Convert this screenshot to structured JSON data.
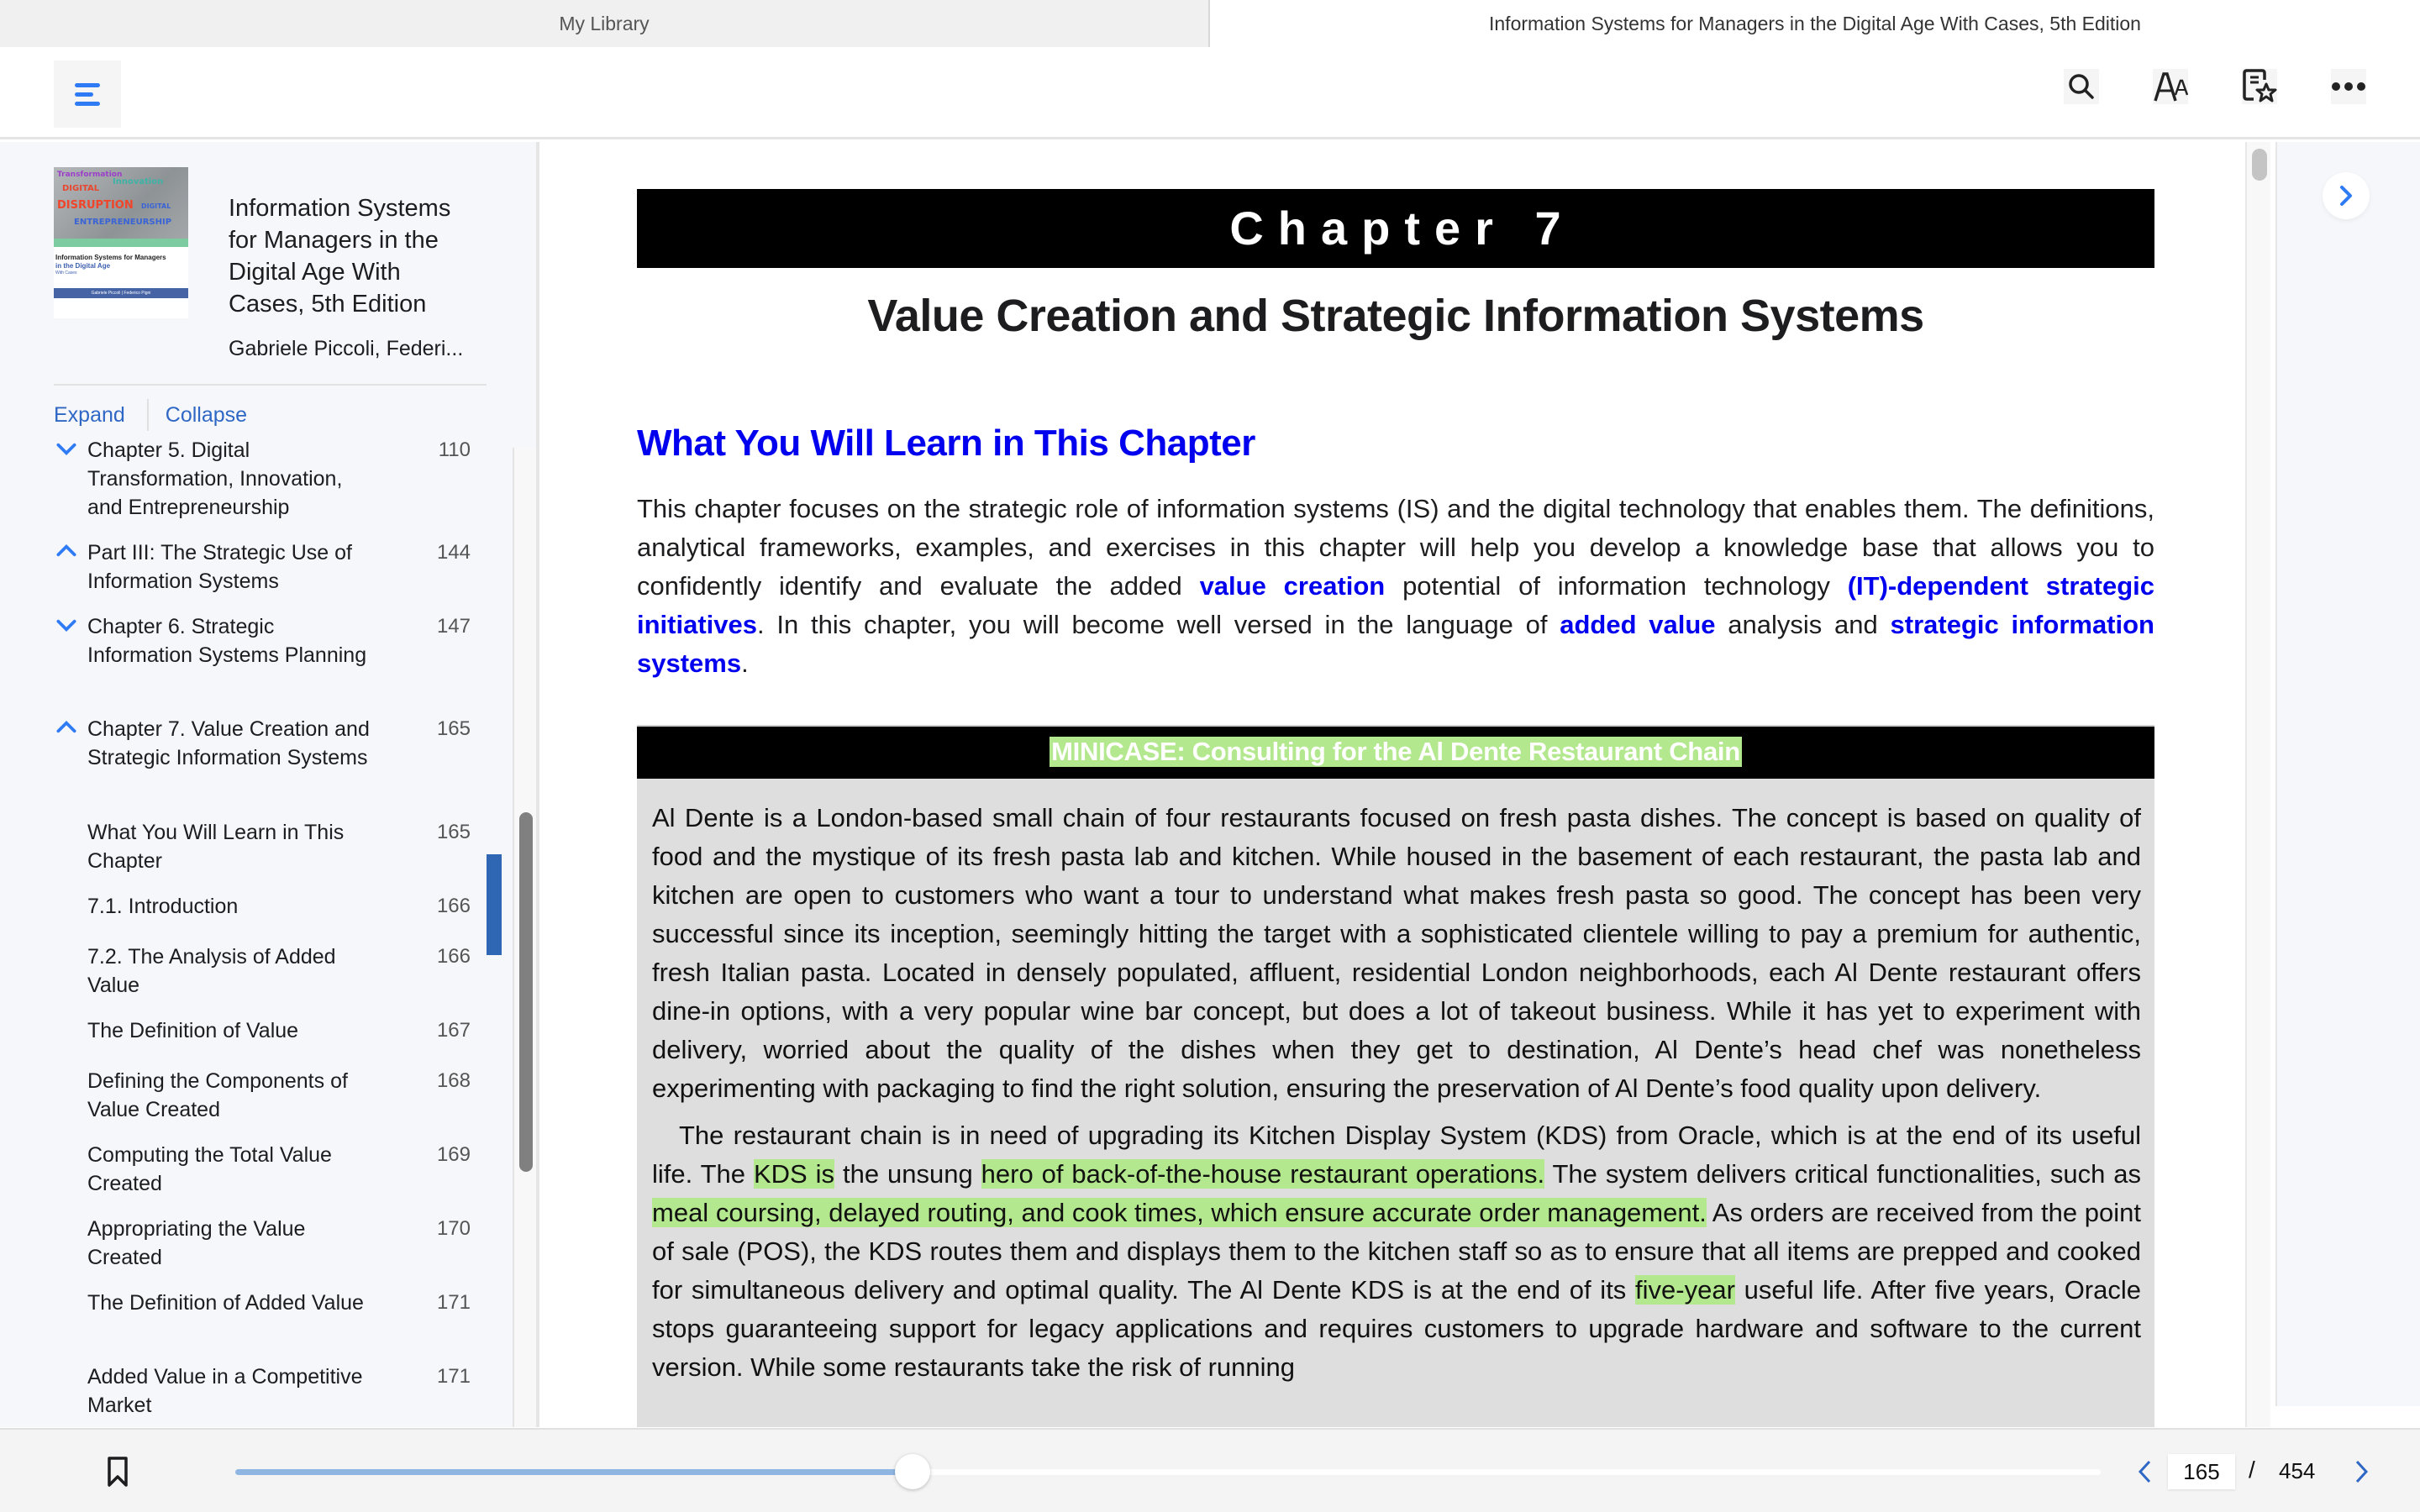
{
  "window": {
    "tabs": [
      {
        "label": "My Library",
        "active": false
      },
      {
        "label": "Information Systems for Managers in the Digital Age With Cases,  5th Edition",
        "active": true
      }
    ]
  },
  "toolbar": {
    "menu_icon": "hamburger-menu-icon",
    "actions": [
      {
        "name": "search",
        "icon": "search-icon"
      },
      {
        "name": "font-size",
        "icon": "text-size-icon"
      },
      {
        "name": "notes-bookmarks",
        "icon": "bookmarked-notes-icon"
      },
      {
        "name": "more",
        "icon": "more-horizontal-icon"
      }
    ]
  },
  "sidebar": {
    "book": {
      "title": "Information Systems for Managers in the Digital Age With Cases,  5th Edition",
      "author": "Gabriele Piccoli, Federi...",
      "cover": {
        "words": [
          "Transformation",
          "DIGITAL",
          "Innovation",
          "DISRUPTION",
          "DIGITAL",
          "ENTREPRENEURSHIP"
        ],
        "title_line1": "Information Systems for Managers",
        "title_line2": "in the Digital Age",
        "title_line3": "With Cases",
        "authors": "Gabriele Piccoli | Federico Pigni"
      },
      "more_label": "•••"
    },
    "expand_label": "Expand",
    "collapse_label": "Collapse",
    "toc": [
      {
        "label": "Chapter 5. Digital Transformation, Innovation, and Entrepreneurship",
        "page": "110",
        "toggle": "collapsed",
        "level": 1
      },
      {
        "label": "Part III: The Strategic Use of Information Systems",
        "page": "144",
        "toggle": "expanded",
        "level": 1
      },
      {
        "label": "Chapter 6. Strategic Information Systems Planning",
        "page": "147",
        "toggle": "collapsed",
        "level": 1
      },
      {
        "label": "Chapter 7. Value Creation and Strategic Information Systems",
        "page": "165",
        "toggle": "expanded",
        "level": 1,
        "current": true
      },
      {
        "label": "What You Will Learn in This Chapter",
        "page": "165",
        "level": 2
      },
      {
        "label": "7.1. Introduction",
        "page": "166",
        "level": 2
      },
      {
        "label": "7.2. The Analysis of Added Value",
        "page": "166",
        "level": 2
      },
      {
        "label": "The Definition of Value",
        "page": "167",
        "level": 2
      },
      {
        "label": "Defining the Components of Value Created",
        "page": "168",
        "level": 2
      },
      {
        "label": "Computing the Total Value Created",
        "page": "169",
        "level": 2
      },
      {
        "label": "Appropriating the Value Created",
        "page": "170",
        "level": 2
      },
      {
        "label": "The Definition of Added Value",
        "page": "171",
        "level": 2
      },
      {
        "label": "Added Value in a Competitive Market",
        "page": "171",
        "level": 2
      }
    ]
  },
  "content": {
    "chapter_banner": "Chapter 7",
    "chapter_title": "Value Creation and Strategic Information Systems",
    "section_heading": "What You Will Learn in This Chapter",
    "intro": {
      "t1": "This chapter focuses on the strategic role of information systems (IS) and the digital technology that enables them. The definitions, analytical frameworks, examples, and exercises in this chapter will help you develop a knowledge base that allows you to confidently identify and evaluate the added ",
      "k1": "value creation",
      "t2": " potential of information technology ",
      "k2": "(IT)-dependent strategic initiatives",
      "t3": ". In this chapter, you will become well versed in the language of ",
      "k3": "added value",
      "t4": " analysis and ",
      "k4": "strategic information systems",
      "t5": "."
    },
    "minicase": {
      "heading": "MINICASE: Consulting for the Al Dente Restaurant Chain",
      "p1": "Al Dente is a London-based small chain of four restaurants focused on fresh pasta dishes. The concept is based on quality of food and the mystique of its fresh pasta lab and kitchen. While housed in the basement of each restaurant, the pasta lab and kitchen are open to customers who want a tour to understand what makes fresh pasta so good. The concept has been very successful since its inception, seemingly hitting the target with a sophisticated clientele willing to pay a premium for authentic, fresh Italian pasta. Located in densely populated, affluent, residential London neighborhoods, each Al Dente restaurant offers dine-in options, with a very popular wine bar concept, but does a lot of takeout business. While it has yet to experiment with delivery, worried about the quality of the dishes when they get to destination, Al Dente’s head chef was nonetheless experimenting with packaging to find the right solution, ensuring the preservation of Al Dente’s food quality upon delivery.",
      "p2": {
        "a": "The restaurant chain is in need of upgrading its Kitchen Display System (KDS) from Oracle, which is at the end of its useful life. The ",
        "h1": "KDS is",
        "b": " the unsung ",
        "h2": "hero of back-of-the-house restaurant operations.",
        "c": " The system delivers critical functionalities, such as ",
        "h3": "meal coursing, delayed routing, and cook times, which ensure accurate order management.",
        "d": " As orders are received from the point of sale (POS), the KDS routes them and displays them to the kitchen staff so as to ensure that all items are prepped and cooked for simultaneous delivery and optimal quality. The Al Dente KDS is at the end of its ",
        "h4": "five-year",
        "e": " useful life. After five years, Oracle stops guaranteeing support for legacy applications and requires customers to upgrade hardware and software to the current version. While some restaurants take the risk of running"
      }
    },
    "colors": {
      "keyword": "#0000ee",
      "highlight": "#b4e88e",
      "accent": "#2f7bf5"
    }
  },
  "footer": {
    "bookmark_icon": "bookmark-icon",
    "progress_fraction": 0.363,
    "current_page": "165",
    "separator": "/",
    "total_pages": "454"
  }
}
